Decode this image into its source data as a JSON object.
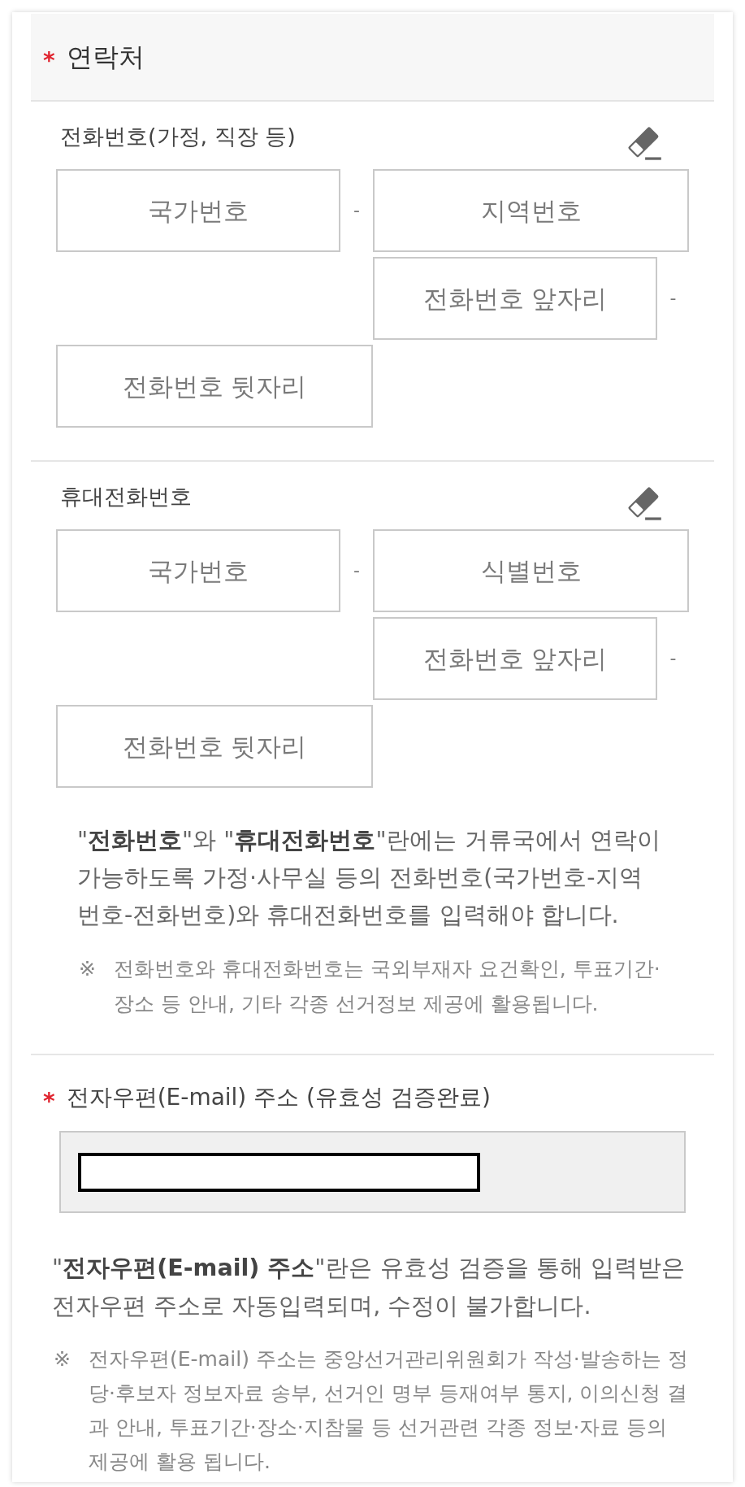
{
  "section": {
    "required_mark": "*",
    "title": "연락처"
  },
  "phone_groups": [
    {
      "label": "전화번호(가정, 직장 등)",
      "fields": [
        {
          "placeholder": "국가번호"
        },
        {
          "placeholder": "지역번호"
        },
        {
          "placeholder": "전화번호 앞자리"
        },
        {
          "placeholder": "전화번호 뒷자리"
        }
      ],
      "separators": [
        "-",
        "-"
      ]
    },
    {
      "label": "휴대전화번호",
      "fields": [
        {
          "placeholder": "국가번호"
        },
        {
          "placeholder": "식별번호"
        },
        {
          "placeholder": "전화번호 앞자리"
        },
        {
          "placeholder": "전화번호 뒷자리"
        }
      ],
      "separators": [
        "-",
        "-"
      ]
    }
  ],
  "phone_notice": {
    "text": "\"**전화번호**\"와 \"**휴대전화번호**\"란에는 거류국에서 연락이 가능하도록 가정·사무실 등의 전화번호(국가번호-지역번호-전화번호)와 휴대전화번호를 입력해야 합니다.",
    "note_mark": "※",
    "note": "전화번호와 휴대전화번호는 국외부재자 요건확인, 투표기간·장소 등 안내, 기타 각종 선거정보 제공에 활용됩니다."
  },
  "email": {
    "required_mark": "*",
    "label": "전자우편(E-mail) 주소 (유효성 검증완료)",
    "disabled": true,
    "redacted": true
  },
  "email_notice": {
    "text": "\"**전자우편(E-mail) 주소**\"란은 유효성 검증을 통해 입력받은 전자우편 주소로 자동입력되며, 수정이 불가합니다.",
    "note_mark": "※",
    "note": "전자우편(E-mail) 주소는 중앙선거관리위원회가 작성·발송하는 정당·후보자 정보자료 송부, 선거인 명부 등재여부 통지, 이의신청 결과 안내, 투표기간·장소·지참물 등 선거관련 각종 정보·자료 등의 제공에 활용 됩니다."
  }
}
